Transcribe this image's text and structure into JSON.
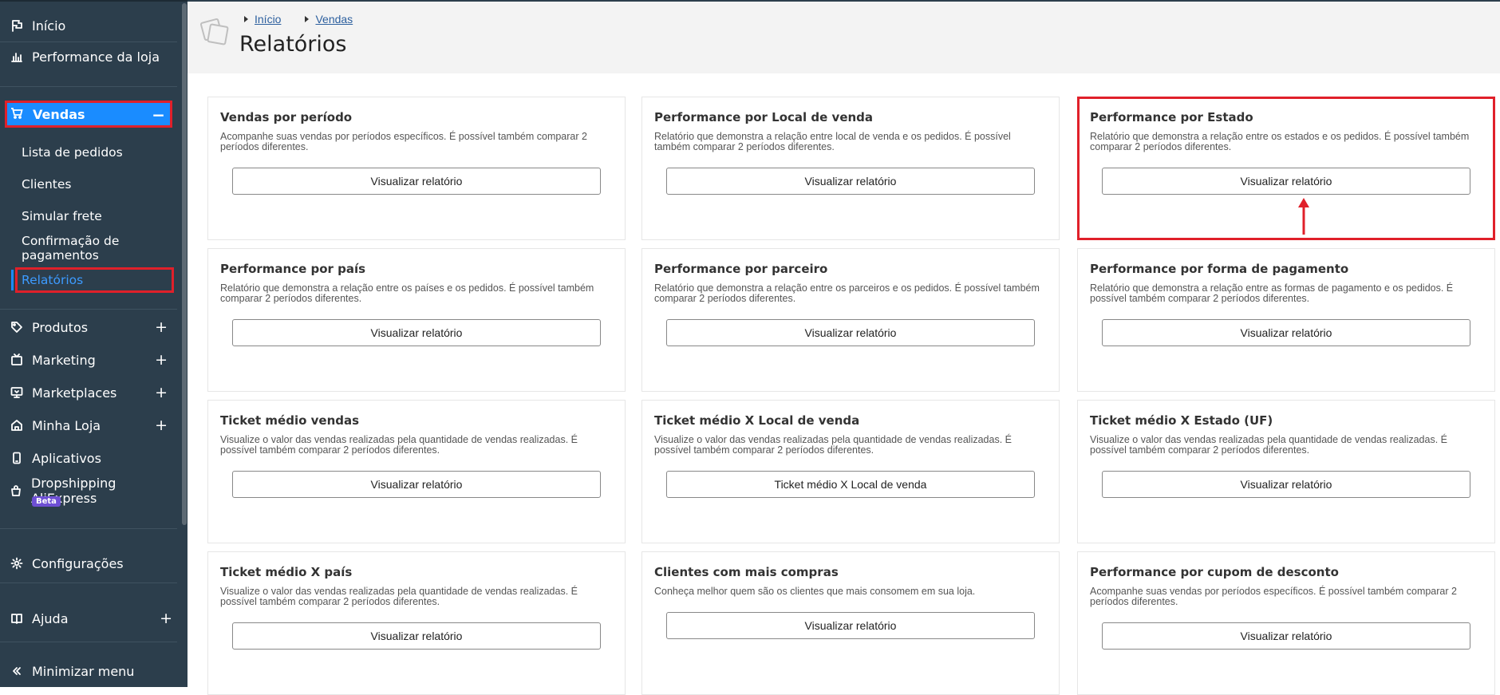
{
  "sidebar": {
    "items": [
      {
        "label": "Início",
        "icon": "flag-icon"
      },
      {
        "label": "Performance da loja",
        "icon": "bar-chart-icon"
      },
      {
        "label": "Vendas",
        "icon": "cart-icon"
      },
      {
        "label": "Produtos",
        "icon": "tag-icon"
      },
      {
        "label": "Marketing",
        "icon": "tv-icon"
      },
      {
        "label": "Marketplaces",
        "icon": "monitor-icon"
      },
      {
        "label": "Minha Loja",
        "icon": "store-icon"
      },
      {
        "label": "Aplicativos",
        "icon": "mobile-icon"
      },
      {
        "label": "Dropshipping AliExpress",
        "icon": "bag-icon",
        "badge": "Beta"
      },
      {
        "label": "Configurações",
        "icon": "gear-icon"
      },
      {
        "label": "Ajuda",
        "icon": "book-icon"
      },
      {
        "label": "Minimizar menu",
        "icon": "double-chevron-left-icon"
      }
    ],
    "expand_symbol": "+",
    "collapse_symbol": "−",
    "vendas_sub": [
      {
        "label": "Lista de pedidos"
      },
      {
        "label": "Clientes"
      },
      {
        "label": "Simular frete"
      },
      {
        "label": "Confirmação de pagamentos"
      },
      {
        "label": "Relatórios"
      }
    ]
  },
  "header": {
    "breadcrumbs": [
      "Início",
      "Vendas"
    ],
    "title": "Relatórios"
  },
  "cards": [
    {
      "title": "Vendas por período",
      "desc": "Acompanhe suas vendas por períodos específicos. É possível também comparar 2 períodos diferentes.",
      "button": "Visualizar relatório"
    },
    {
      "title": "Performance por Local de venda",
      "desc": "Relatório que demonstra a relação entre local de venda e os pedidos. É possível também comparar 2 períodos diferentes.",
      "button": "Visualizar relatório"
    },
    {
      "title": "Performance por Estado",
      "desc": "Relatório que demonstra a relação entre os estados e os pedidos. É possível também comparar 2 períodos diferentes.",
      "button": "Visualizar relatório"
    },
    {
      "title": "Performance por país",
      "desc": "Relatório que demonstra a relação entre os países e os pedidos. É possível também comparar 2 períodos diferentes.",
      "button": "Visualizar relatório"
    },
    {
      "title": "Performance por parceiro",
      "desc": "Relatório que demonstra a relação entre os parceiros e os pedidos. É possível também comparar 2 períodos diferentes.",
      "button": "Visualizar relatório"
    },
    {
      "title": "Performance por forma de pagamento",
      "desc": "Relatório que demonstra a relação entre as formas de pagamento e os pedidos. É possível também comparar 2 períodos diferentes.",
      "button": "Visualizar relatório"
    },
    {
      "title": "Ticket médio vendas",
      "desc": "Visualize o valor das vendas realizadas pela quantidade de vendas realizadas. É possível também comparar 2 períodos diferentes.",
      "button": "Visualizar relatório"
    },
    {
      "title": "Ticket médio X Local de venda",
      "desc": "Visualize o valor das vendas realizadas pela quantidade de vendas realizadas. É possível também comparar 2 períodos diferentes.",
      "button": "Ticket médio X Local de venda"
    },
    {
      "title": "Ticket médio X Estado (UF)",
      "desc": "Visualize o valor das vendas realizadas pela quantidade de vendas realizadas. É possível também comparar 2 períodos diferentes.",
      "button": "Visualizar relatório"
    },
    {
      "title": "Ticket médio X país",
      "desc": "Visualize o valor das vendas realizadas pela quantidade de vendas realizadas. É possível também comparar 2 períodos diferentes.",
      "button": "Visualizar relatório"
    },
    {
      "title": "Clientes com mais compras",
      "desc": "Conheça melhor quem são os clientes que mais consomem em sua loja.",
      "button": "Visualizar relatório"
    },
    {
      "title": "Performance por cupom de desconto",
      "desc": "Acompanhe suas vendas por períodos específicos. É possível também comparar 2 períodos diferentes.",
      "button": "Visualizar relatório"
    }
  ],
  "colors": {
    "sidebar_bg": "#2c3e4c",
    "active_blue": "#1a8cff",
    "highlight_red": "#e0202a"
  }
}
